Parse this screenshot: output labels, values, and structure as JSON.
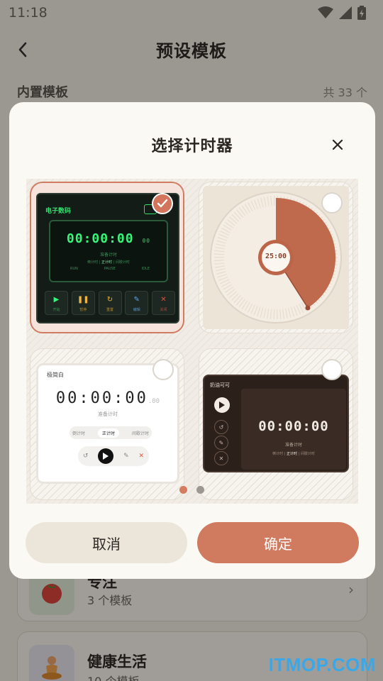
{
  "status_bar": {
    "time": "11:18"
  },
  "header": {
    "title": "预设模板"
  },
  "section": {
    "title": "内置模板",
    "count": "共 33 个"
  },
  "categories": [
    {
      "name": "专注",
      "sub": "3 个模板"
    },
    {
      "name": "健康生活",
      "sub": "10 个模板"
    }
  ],
  "dialog": {
    "title": "选择计时器",
    "cancel_label": "取消",
    "confirm_label": "确定",
    "selected_index": 0,
    "page_indicator": {
      "current": 1,
      "total": 2
    },
    "options": [
      {
        "name": "电子数码",
        "time": "00:00:00",
        "small_time": "00",
        "subtitle": "准备计时",
        "modes": [
          "倒计时",
          "正计时",
          "间歇计时"
        ],
        "indicators": [
          "RUN",
          "PAUSE",
          "IDLE"
        ],
        "buttons": [
          "开始",
          "暂停",
          "重置",
          "编辑",
          "关闭"
        ]
      },
      {
        "time": "25:00"
      },
      {
        "name": "极简白",
        "time": "00:00:00",
        "small_time": ".00",
        "subtitle": "准备计时",
        "modes": [
          "倒计时",
          "正计时",
          "间歇计时"
        ]
      },
      {
        "name": "奶油可可",
        "time": "00:00:00",
        "subtitle": "准备计时",
        "modes": [
          "倒计时",
          "正计时",
          "间歇计时"
        ]
      }
    ]
  },
  "colors": {
    "accent": "#d07a5f",
    "digital_green": "#35f57a",
    "background": "#efe9df"
  },
  "watermark": "ITMOP.COM"
}
